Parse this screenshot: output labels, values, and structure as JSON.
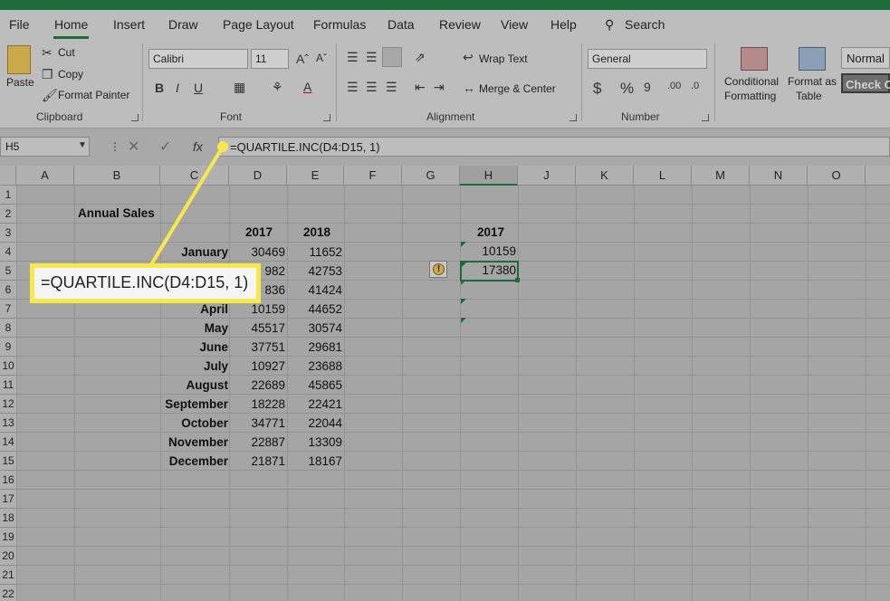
{
  "ribbon_tabs": [
    "File",
    "Home",
    "Insert",
    "Draw",
    "Page Layout",
    "Formulas",
    "Data",
    "Review",
    "View",
    "Help",
    "Search"
  ],
  "clipboard": {
    "paste": "Paste",
    "cut": "Cut",
    "copy": "Copy",
    "format_painter": "Format Painter",
    "label": "Clipboard"
  },
  "font": {
    "name": "Calibri",
    "size": "11",
    "label": "Font"
  },
  "alignment": {
    "wrap": "Wrap Text",
    "merge": "Merge & Center",
    "label": "Alignment"
  },
  "number": {
    "format": "General",
    "label": "Number"
  },
  "styles": {
    "conditional_1": "Conditional",
    "conditional_2": "Formatting",
    "table_1": "Format as",
    "table_2": "Table",
    "normal": "Normal",
    "check": "Check C"
  },
  "formula_bar": {
    "name_box": "H5",
    "formula": "=QUARTILE.INC(D4:D15, 1)"
  },
  "columns": [
    "A",
    "B",
    "C",
    "D",
    "E",
    "F",
    "G",
    "H",
    "J",
    "K",
    "L",
    "M",
    "N",
    "O"
  ],
  "rows": [
    "1",
    "2",
    "3",
    "4",
    "5",
    "6",
    "7",
    "8",
    "9",
    "10",
    "11",
    "12",
    "13",
    "14",
    "15",
    "16",
    "17",
    "18",
    "19",
    "20",
    "21",
    "22"
  ],
  "sheet": {
    "title": "Annual Sales",
    "year_a": "2017",
    "year_b": "2018",
    "months": [
      "January",
      "",
      "",
      "April",
      "May",
      "June",
      "July",
      "August",
      "September",
      "October",
      "November",
      "December"
    ],
    "d_values": [
      "30469",
      "982",
      "836",
      "10159",
      "45517",
      "37751",
      "10927",
      "22689",
      "18228",
      "34771",
      "22887",
      "21871"
    ],
    "e_values": [
      "11652",
      "42753",
      "41424",
      "44652",
      "30574",
      "29681",
      "23688",
      "45865",
      "22421",
      "22044",
      "13309",
      "18167"
    ],
    "h_header": "2017",
    "h4": "10159",
    "h5": "17380"
  },
  "callout": {
    "text": "=QUARTILE.INC(D4:D15, 1)"
  }
}
